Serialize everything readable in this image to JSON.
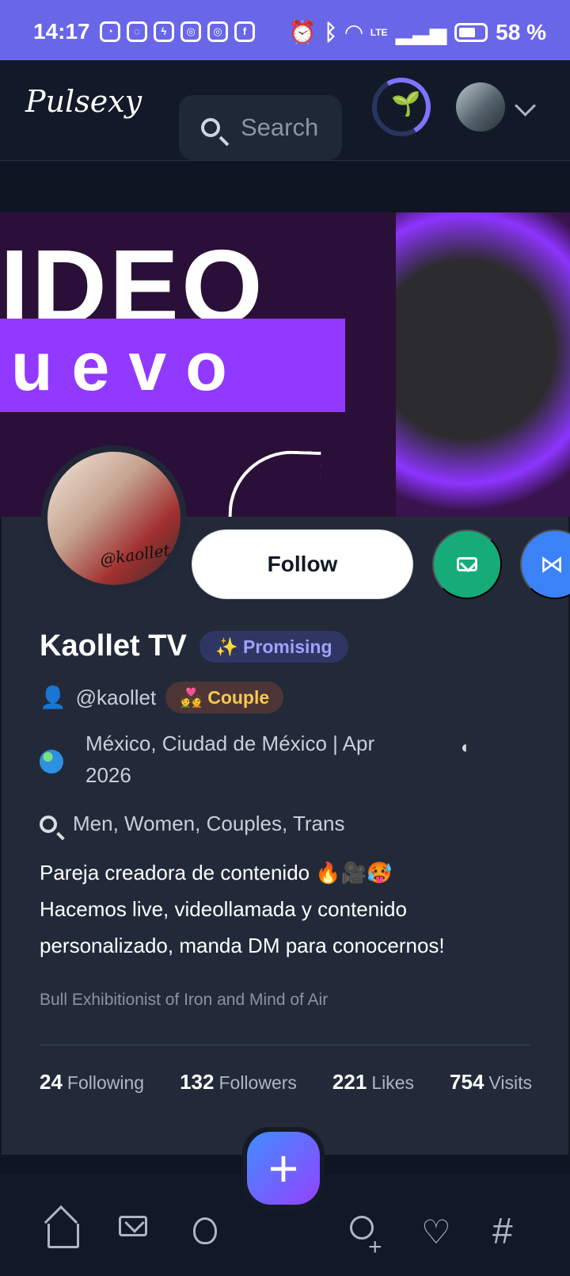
{
  "status_bar": {
    "time": "14:17",
    "battery": "58 %",
    "network": "LTE",
    "apps": [
      "activity-icon",
      "whatsapp-icon",
      "messenger-icon",
      "instagram-icon",
      "instagram-icon",
      "facebook-icon"
    ]
  },
  "header": {
    "logo": "Pulsexy",
    "search_placeholder": "Search",
    "progress_ring_color": "#7f73ff"
  },
  "profile": {
    "name": "Kaollet TV",
    "badge": "✨ Promising",
    "handle": "@kaollet",
    "tag": "💑 Couple",
    "location": "México, Ciudad de México | Apr 2026",
    "interests": "Men, Women, Couples, Trans",
    "bio_line_1": "Pareja creadora de contenido 🔥🎥🥵",
    "bio_line_2": "Hacemos live, videollamada y contenido personalizado, manda DM para conocernos!",
    "subtitle": "Bull Exhibitionist of Iron and Mind of Air",
    "profile_pic_text": "@kaollet"
  },
  "banner": {
    "line_1": "IDEO",
    "line_2": "uevo"
  },
  "actions": {
    "follow": "Follow"
  },
  "stats": [
    {
      "value": "24",
      "label": "Following"
    },
    {
      "value": "132",
      "label": "Followers"
    },
    {
      "value": "221",
      "label": "Likes"
    },
    {
      "value": "754",
      "label": "Visits"
    }
  ],
  "bottom_nav": {
    "add_label": "+"
  },
  "colors": {
    "status_bar": "#6966e8",
    "background": "#0f1523",
    "card": "#222a39",
    "follow_button": "#ffffff",
    "mail_button": "#16ac79",
    "share_button": "#3b82f6",
    "accent": "#9139ff"
  }
}
